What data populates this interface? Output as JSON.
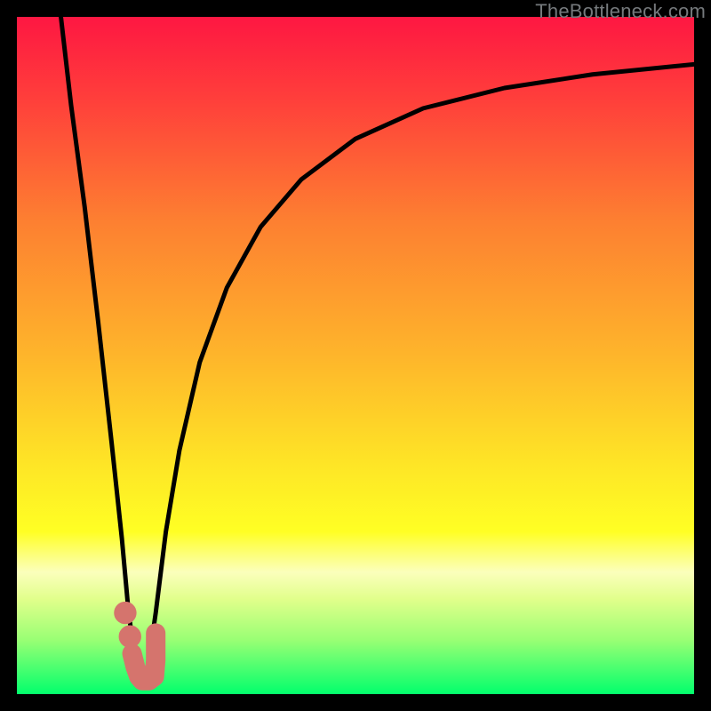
{
  "watermark": "TheBottleneck.com",
  "colors": {
    "curve": "#000000",
    "marker_fill": "#d5746d",
    "marker_stroke": "#d5746d",
    "gradient_stops": [
      {
        "offset": 0.0,
        "color": "#fe1742"
      },
      {
        "offset": 0.12,
        "color": "#ff3e3b"
      },
      {
        "offset": 0.3,
        "color": "#fd7f31"
      },
      {
        "offset": 0.5,
        "color": "#feb52b"
      },
      {
        "offset": 0.66,
        "color": "#fee526"
      },
      {
        "offset": 0.76,
        "color": "#ffff24"
      },
      {
        "offset": 0.82,
        "color": "#fbffbc"
      },
      {
        "offset": 0.86,
        "color": "#e1ff8b"
      },
      {
        "offset": 0.92,
        "color": "#99ff74"
      },
      {
        "offset": 1.0,
        "color": "#02ff6c"
      }
    ]
  },
  "chart_data": {
    "type": "line",
    "title": "",
    "xlabel": "",
    "ylabel": "",
    "xlim": [
      0,
      100
    ],
    "ylim": [
      0,
      100
    ],
    "series": [
      {
        "name": "left-branch",
        "x": [
          6.5,
          8.0,
          10.0,
          12.0,
          14.0,
          15.5,
          16.5,
          17.5
        ],
        "values": [
          100,
          87,
          72,
          55,
          37,
          23,
          12,
          5
        ]
      },
      {
        "name": "right-branch",
        "x": [
          19.5,
          20.5,
          22.0,
          24.0,
          27.0,
          31.0,
          36.0,
          42.0,
          50.0,
          60.0,
          72.0,
          85.0,
          100.0
        ],
        "values": [
          5,
          12,
          24,
          36,
          49,
          60,
          69,
          76,
          82,
          86.5,
          89.5,
          91.5,
          93.0
        ]
      },
      {
        "name": "valley-highlight",
        "x": [
          17.0,
          17.5,
          18.0,
          18.5,
          19.5,
          20.3,
          20.5,
          20.5
        ],
        "values": [
          6.0,
          4.0,
          2.6,
          2.0,
          2.0,
          2.6,
          5.0,
          9.0
        ]
      }
    ],
    "markers": [
      {
        "name": "marker-upper",
        "x": 16.0,
        "y": 12.0,
        "r": 1.6
      },
      {
        "name": "marker-lower",
        "x": 16.7,
        "y": 8.5,
        "r": 1.6
      }
    ]
  }
}
